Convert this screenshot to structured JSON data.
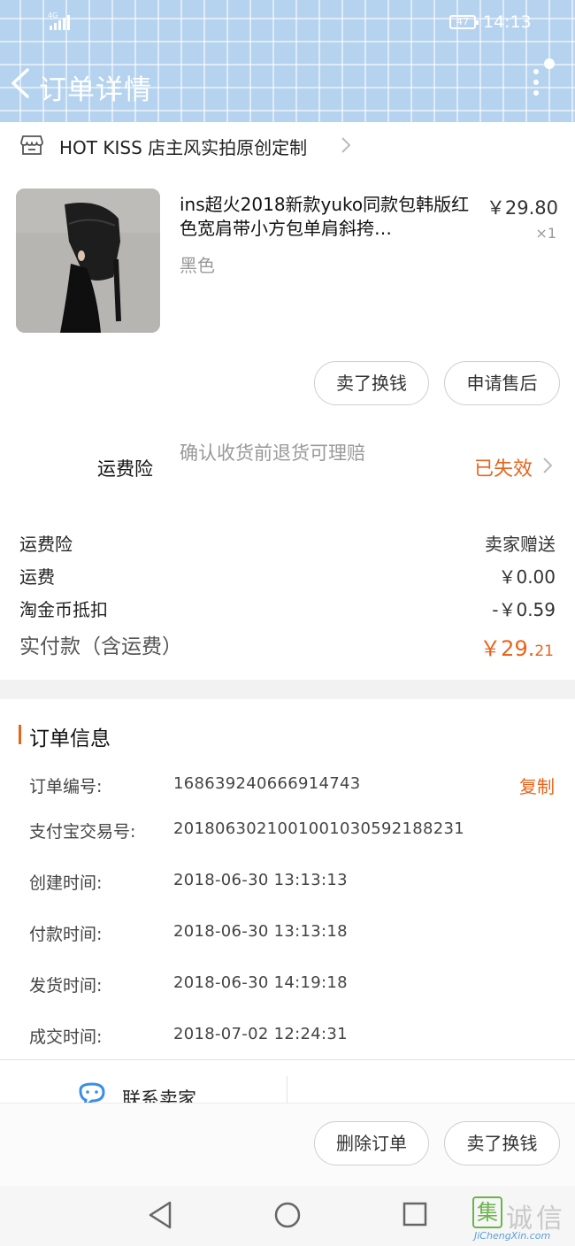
{
  "status_bar": {
    "network": "4G",
    "battery": "47",
    "time": "14:13"
  },
  "header": {
    "title": "订单详情"
  },
  "shop": {
    "name": "HOT KISS 店主风实拍原创定制"
  },
  "product": {
    "title": "ins超火2018新款yuko同款包韩版红色宽肩带小方包单肩斜挎…",
    "sku": "黑色",
    "price": "￥29.80",
    "quantity": "×1"
  },
  "product_actions": {
    "sell_label": "卖了换钱",
    "after_sale_label": "申请售后"
  },
  "insurance": {
    "label": "运费险",
    "description": "确认收货前退货可理赔",
    "status": "已失效"
  },
  "fees": [
    {
      "label": "运费险",
      "value": "卖家赠送"
    },
    {
      "label": "运费",
      "value": "￥0.00"
    },
    {
      "label": "淘金币抵扣",
      "value": "-￥0.59"
    }
  ],
  "total": {
    "label": "实付款（含运费）",
    "value_int": "￥29.",
    "value_dec": "21"
  },
  "order_info": {
    "title": "订单信息",
    "copy_label": "复制",
    "rows": [
      {
        "key": "订单编号:",
        "value": "168639240666914743"
      },
      {
        "key": "支付宝交易号:",
        "value": "2018063021001001030592188231"
      },
      {
        "key": "创建时间:",
        "value": "2018-06-30  13:13:13"
      },
      {
        "key": "付款时间:",
        "value": "2018-06-30  13:13:18"
      },
      {
        "key": "发货时间:",
        "value": "2018-06-30  14:19:18"
      },
      {
        "key": "成交时间:",
        "value": "2018-07-02  12:24:31"
      }
    ]
  },
  "contact": {
    "label": "联系卖家"
  },
  "bottom_actions": {
    "delete_label": "删除订单",
    "sell_label": "卖了换钱"
  },
  "watermark": {
    "glyph": "集",
    "text": "诚信",
    "url": "JiChengXin.com"
  },
  "colors": {
    "accent": "#e8641b",
    "header_bg": "#b5d3ee",
    "watermark_green": "#6bb34a"
  }
}
